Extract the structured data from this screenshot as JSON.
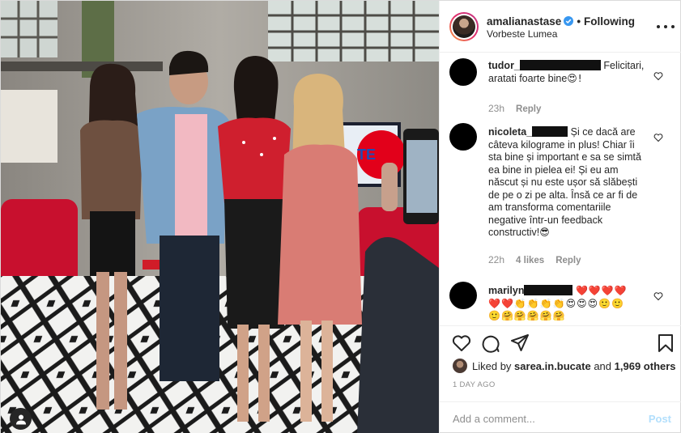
{
  "post": {
    "photo_alt": "",
    "tv_logo": "TE"
  },
  "header": {
    "username": "amalianastase",
    "separator": "•",
    "follow_state": "Following",
    "location": "Vorbeste Lumea"
  },
  "comments": [
    {
      "username": "tudor_",
      "text_lines": [
        "Felicitari,",
        "aratati foarte bine"
      ],
      "emojis": "😍!",
      "time": "23h",
      "likes": "",
      "reply_label": "Reply"
    },
    {
      "username": "nicoleta_",
      "text_lines": [
        "Și ce dacă are",
        "câteva kilograme in plus! Chiar îi",
        "sta bine și important e sa se simtă",
        "ea bine in pielea ei! Și eu am",
        "născut și nu este ușor să slăbești",
        "de pe o zi pe alta. Însă ce ar fi de",
        "am transforma comentariile",
        "negative într-un feedback",
        "constructiv!"
      ],
      "emojis": "😎",
      "time": "22h",
      "likes": "4 likes",
      "reply_label": "Reply"
    },
    {
      "username": "marilyn",
      "emoji_line1": "❤️❤️❤️❤️",
      "emoji_line2": "❤️❤️👏👏👏👏😍😍😍🙂🙂",
      "emoji_line3": "🙂🤗🤗🤗🤗🤗"
    }
  ],
  "likes": {
    "prefix": "Liked by",
    "user": "sarea.in.bucate",
    "middle": "and",
    "others": "1,969 others"
  },
  "timestamp": "1 DAY AGO",
  "composer": {
    "placeholder": "Add a comment...",
    "post_label": "Post"
  },
  "colors": {
    "accent_blue": "#0095f6",
    "post_disabled": "#b2dffc",
    "verified": "#3897f0",
    "muted": "#8e8e8e"
  }
}
